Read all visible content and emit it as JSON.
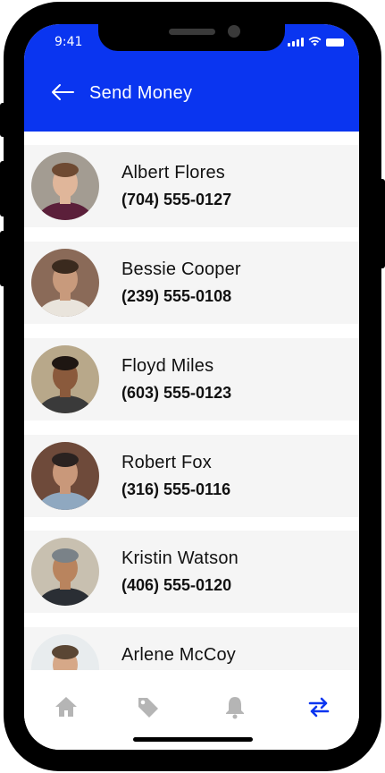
{
  "status_bar": {
    "time": "9:41"
  },
  "header": {
    "title": "Send Money",
    "back_icon": "arrow-left-icon"
  },
  "contacts": [
    {
      "name": "Albert Flores",
      "phone": "(704) 555-0127",
      "skin": "#e0b69a",
      "hair": "#6e4a32",
      "shirt": "#5b1f3a",
      "bg": "#a39c92"
    },
    {
      "name": "Bessie Cooper",
      "phone": "(239) 555-0108",
      "skin": "#c89a7c",
      "hair": "#3a2a1e",
      "shirt": "#e9e4dc",
      "bg": "#8a6a58"
    },
    {
      "name": "Floyd Miles",
      "phone": "(603) 555-0123",
      "skin": "#8a5a3c",
      "hair": "#1e1612",
      "shirt": "#3a3a3a",
      "bg": "#b8a88a"
    },
    {
      "name": "Robert Fox",
      "phone": "(316) 555-0116",
      "skin": "#c9987a",
      "hair": "#2a2220",
      "shirt": "#8fa8c0",
      "bg": "#6e4a3a"
    },
    {
      "name": "Kristin Watson",
      "phone": "(406) 555-0120",
      "skin": "#b9845e",
      "hair": "#7a8288",
      "shirt": "#2a2e34",
      "bg": "#c8c0b0"
    },
    {
      "name": "Arlene McCoy",
      "phone": "",
      "skin": "#d6a888",
      "hair": "#5a4634",
      "shirt": "#ffffff",
      "bg": "#e8ecee"
    }
  ],
  "nav": [
    {
      "icon": "home-icon",
      "active": false
    },
    {
      "icon": "tag-icon",
      "active": false
    },
    {
      "icon": "bell-icon",
      "active": false
    },
    {
      "icon": "transfer-icon",
      "active": true
    }
  ],
  "colors": {
    "primary": "#0a35f0",
    "inactive": "#b5b5b5",
    "row_bg": "#f5f5f5"
  }
}
